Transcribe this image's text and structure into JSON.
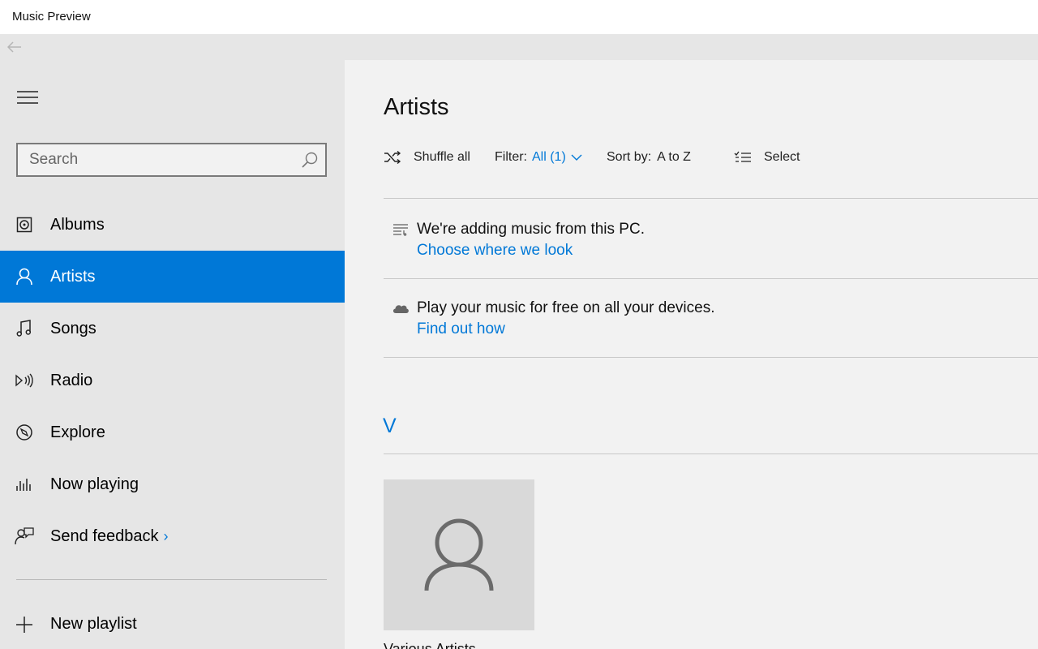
{
  "window": {
    "title": "Music Preview"
  },
  "search": {
    "placeholder": "Search"
  },
  "nav": {
    "items": [
      {
        "label": "Albums",
        "icon": "album-icon"
      },
      {
        "label": "Artists",
        "icon": "person-icon",
        "active": true
      },
      {
        "label": "Songs",
        "icon": "music-note-icon"
      },
      {
        "label": "Radio",
        "icon": "radio-icon"
      },
      {
        "label": "Explore",
        "icon": "explore-icon"
      },
      {
        "label": "Now playing",
        "icon": "equalizer-icon"
      },
      {
        "label": "Send feedback",
        "icon": "feedback-icon",
        "chevron": "›"
      }
    ],
    "new_playlist": {
      "label": "New playlist",
      "icon": "plus-icon"
    }
  },
  "main": {
    "title": "Artists",
    "toolbar": {
      "shuffle": "Shuffle all",
      "filter_label": "Filter:",
      "filter_value": "All (1)",
      "sort_label": "Sort by:",
      "sort_value": "A to Z",
      "select": "Select"
    },
    "notices": [
      {
        "icon": "library-icon",
        "text": "We're adding music from this PC.",
        "link": "Choose where we look"
      },
      {
        "icon": "cloud-icon",
        "text": "Play your music for free on all your devices.",
        "link": "Find out how"
      }
    ],
    "group_letter": "V",
    "artists": [
      {
        "name": "Various Artists"
      }
    ]
  },
  "colors": {
    "accent": "#0078d7",
    "sidebar_bg": "#e6e6e6",
    "main_bg": "#f2f2f2",
    "tile_bg": "#d9d9d9"
  }
}
